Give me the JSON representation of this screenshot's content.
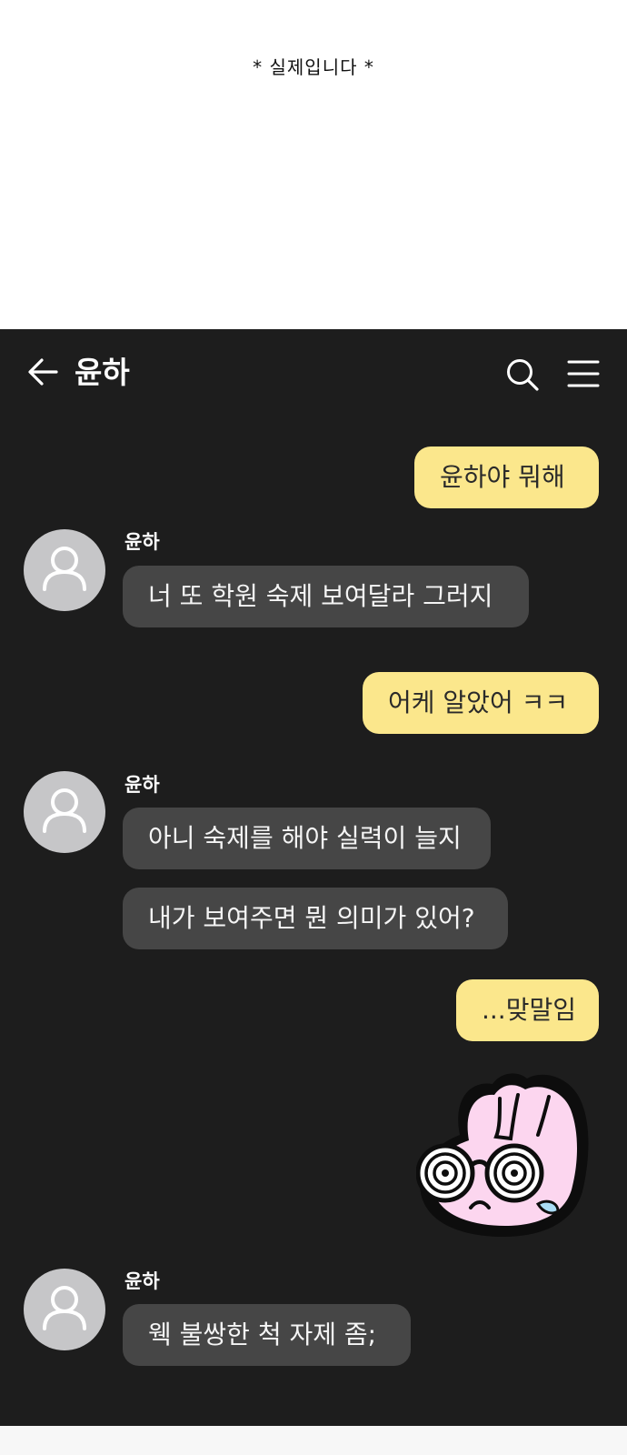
{
  "caption": "* 실제입니다 *",
  "header": {
    "title": "윤하",
    "back_icon": "arrow-left-icon",
    "search_icon": "search-icon",
    "menu_icon": "hamburger-menu-icon"
  },
  "colors": {
    "chat_background": "#1d1d1d",
    "my_bubble": "#fbe78c",
    "other_bubble": "#464646",
    "avatar": "#c6c6c8"
  },
  "messages": [
    {
      "from": "me",
      "text": "윤하야 뭐해"
    },
    {
      "from": "other",
      "sender": "윤하",
      "text": "너 또 학원 숙제 보여달라 그러지"
    },
    {
      "from": "me",
      "text": "어케 알았어 ㅋㅋ"
    },
    {
      "from": "other",
      "sender": "윤하",
      "text": "아니 숙제를 해야 실력이 늘지"
    },
    {
      "from": "other",
      "text": "내가 보여주면 뭔 의미가 있어?"
    },
    {
      "from": "me",
      "text": "...맞말임"
    },
    {
      "from": "me",
      "sticker": "dizzy-bunny-sticker"
    },
    {
      "from": "other",
      "sender": "윤하",
      "text": "웩 불쌍한 척 자제 좀;"
    }
  ]
}
